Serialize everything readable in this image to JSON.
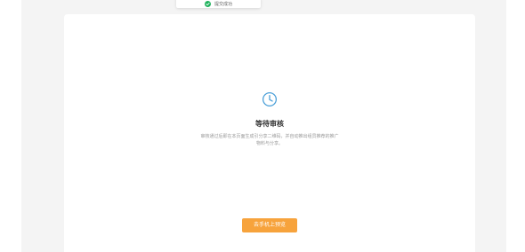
{
  "toast": {
    "icon": "check-circle-icon",
    "icon_color": "#22b35e",
    "text": "提交成功"
  },
  "review": {
    "icon": "clock-icon",
    "icon_color": "#4a9fd8",
    "title": "等待审核",
    "description": "审核通过后即在本页面生成引分享二维码，并自动推出组员推荐的推广物料与分享。"
  },
  "actions": {
    "preview_button_label": "去手机上预览",
    "preview_button_color": "#f7a33c"
  }
}
